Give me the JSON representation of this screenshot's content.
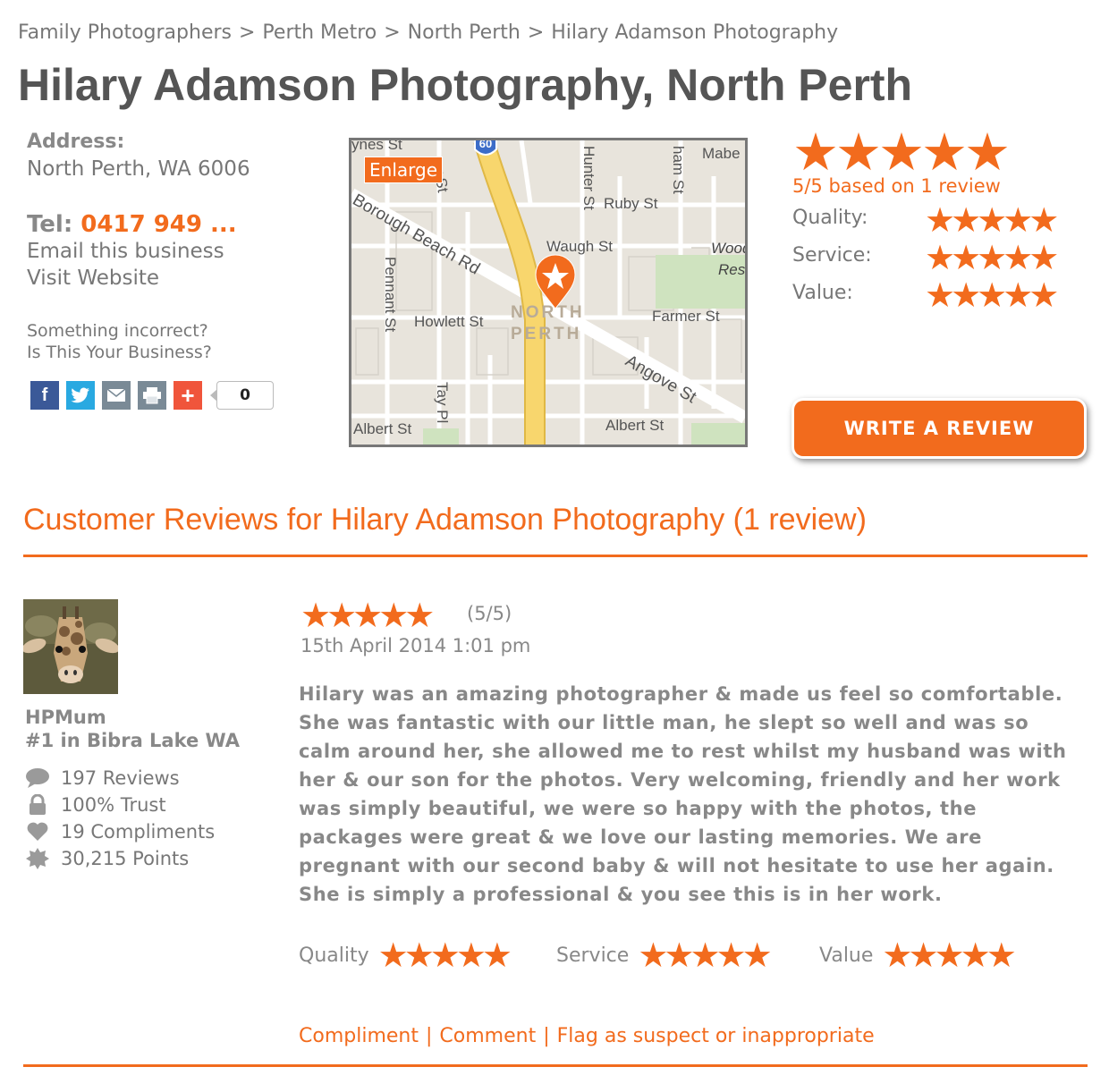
{
  "breadcrumb": [
    "Family Photographers",
    "Perth Metro",
    "North Perth",
    "Hilary Adamson Photography"
  ],
  "breadcrumb_separator": ">",
  "page_title": "Hilary Adamson Photography, North Perth",
  "business": {
    "address_label": "Address:",
    "address": "North Perth, WA 6006",
    "tel_label": "Tel:",
    "tel": "0417 949 ...",
    "email_link": "Email this business",
    "website_link": "Visit Website",
    "incorrect_link": "Something incorrect?",
    "claim_link": "Is This Your Business?"
  },
  "share": {
    "count": "0",
    "buttons": [
      "facebook-icon",
      "twitter-icon",
      "email-icon",
      "print-icon",
      "plus-icon"
    ]
  },
  "map": {
    "enlarge_label": "Enlarge",
    "highway_shield": "60",
    "area_label_1": "NORTH",
    "area_label_2": "PERTH",
    "streets": [
      "Mabe",
      "Hunter St",
      "Ruby St",
      "Waugh St",
      "Wood",
      "Res",
      "Borough Beach Rd",
      "Howlett St",
      "Pennant St",
      "Farmer St",
      "Angove St",
      "Tay Pl",
      "Albert St",
      "Albert St",
      "ham St",
      "y St",
      "ynes St"
    ]
  },
  "rating_summary": {
    "stars": "★★★★★",
    "summary_text": "5/5 based on 1 review",
    "quality_label": "Quality:",
    "service_label": "Service:",
    "value_label": "Value:",
    "quality": 5,
    "service": 5,
    "value": 5
  },
  "write_review_label": "WRITE A REVIEW",
  "reviews_heading": "Customer Reviews for Hilary Adamson Photography (1 review)",
  "review": {
    "user_name": "HPMum",
    "user_rank": "#1 in Bibra Lake WA",
    "reviews_count": "197 Reviews",
    "trust": "100% Trust",
    "compliments": "19 Compliments",
    "points": "30,215 Points",
    "rating": 5,
    "score_text": "(5/5)",
    "date": "15th April 2014 1:01 pm",
    "text": "Hilary was an amazing photographer & made us feel so comfortable. She was fantastic with our little man, he slept so well and was so calm around her, she allowed me to rest whilst my husband was with her & our son for the photos. Very welcoming, friendly and her work was simply beautiful, we were so happy with the photos, the packages were great & we love our lasting memories. We are pregnant with our second baby & will not hesitate to use her again. She is simply a professional & you see this is in her work.",
    "quality_label": "Quality",
    "service_label": "Service",
    "value_label": "Value",
    "actions": [
      "Compliment",
      "Comment",
      "Flag as suspect or inappropriate"
    ]
  },
  "colors": {
    "accent": "#f26b1d",
    "text_gray": "#777777",
    "title_gray": "#555555"
  }
}
